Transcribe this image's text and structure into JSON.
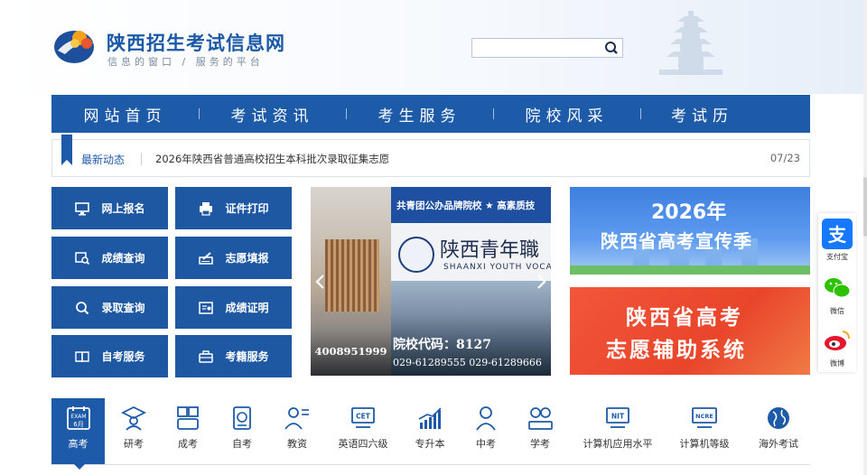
{
  "header": {
    "title": "陕西招生考试信息网",
    "slogan": "信息的窗口 / 服务的平台",
    "search": {
      "placeholder": "",
      "value": ""
    }
  },
  "nav": {
    "items": [
      "网站首页",
      "考试资讯",
      "考生服务",
      "院校风采",
      "考试历"
    ]
  },
  "news": {
    "label": "最新动态",
    "text": "2026年陕西省普通高校招生本科批次录取征集志愿",
    "date": "07/23"
  },
  "services": [
    {
      "label": "网上报名",
      "icon": "monitor-icon"
    },
    {
      "label": "证件打印",
      "icon": "printer-icon"
    },
    {
      "label": "成绩查询",
      "icon": "score-search-icon"
    },
    {
      "label": "志愿填报",
      "icon": "form-fill-icon"
    },
    {
      "label": "录取查询",
      "icon": "search-icon"
    },
    {
      "label": "成绩证明",
      "icon": "certificate-icon"
    },
    {
      "label": "自考服务",
      "icon": "book-icon"
    },
    {
      "label": "考籍服务",
      "icon": "briefcase-icon"
    }
  ],
  "carousel": {
    "phone": "4008951999",
    "topbar": "共青团公办品牌院校 ★ 高素质技",
    "calligraphy": "陕西青年職",
    "english": "SHAANXI YOUTH VOCA",
    "code": "院校代码：8127",
    "tel": "029-61289555   029-61289666"
  },
  "banners": [
    {
      "line1": "2026年",
      "line2": "陕西省高考宣传季"
    },
    {
      "line1": "陕西省高考",
      "line2": "志愿辅助系统"
    }
  ],
  "social": [
    {
      "label": "支付宝",
      "icon": "alipay-icon",
      "color": "#1678ff"
    },
    {
      "label": "微信",
      "icon": "wechat-icon",
      "color": "#2dc100"
    },
    {
      "label": "微博",
      "icon": "weibo-icon",
      "color": "#e6162d"
    }
  ],
  "tabs": [
    {
      "label": "高考",
      "icon": "calendar-exam-icon",
      "badge_top": "EXAM",
      "badge_bottom": "6月",
      "active": true
    },
    {
      "label": "研考",
      "icon": "graduate-icon"
    },
    {
      "label": "成考",
      "icon": "adult-exam-icon"
    },
    {
      "label": "自考",
      "icon": "self-exam-icon"
    },
    {
      "label": "教资",
      "icon": "teacher-icon"
    },
    {
      "label": "英语四六级",
      "icon": "cet-icon",
      "badge": "CET"
    },
    {
      "label": "专升本",
      "icon": "growth-chart-icon"
    },
    {
      "label": "中考",
      "icon": "student-icon"
    },
    {
      "label": "学考",
      "icon": "students-icon"
    },
    {
      "label": "计算机应用水平",
      "icon": "nit-icon",
      "badge": "NIT"
    },
    {
      "label": "计算机等级",
      "icon": "ncre-icon",
      "badge": "NCRE"
    },
    {
      "label": "海外考试",
      "icon": "globe-icon"
    }
  ],
  "colors": {
    "primary": "#1d5aa7",
    "service_tile": "#1e58a3",
    "banner_red": "#e9452b",
    "banner_blue": "#3d7fe0"
  }
}
